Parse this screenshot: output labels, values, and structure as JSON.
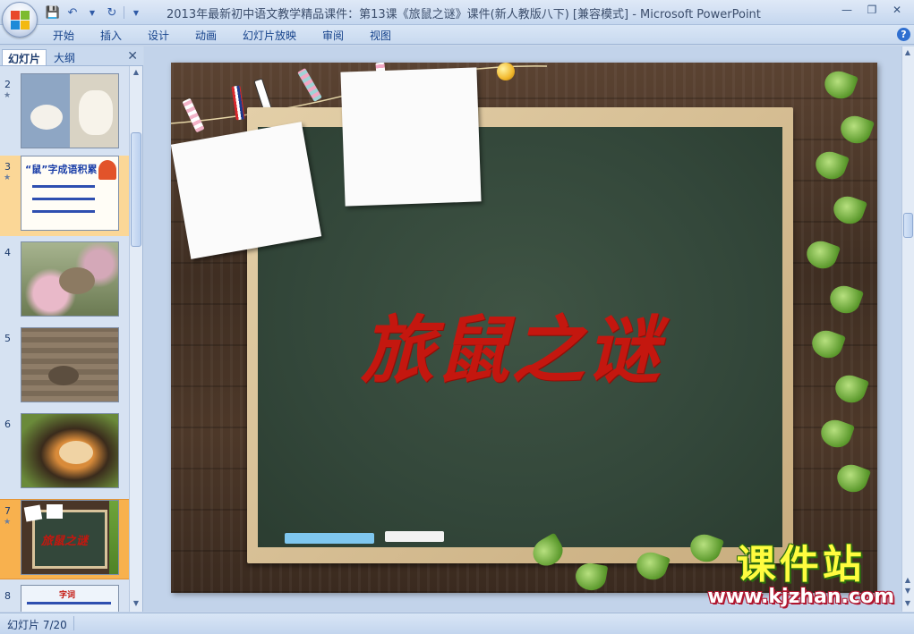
{
  "window": {
    "title": "2013年最新初中语文教学精品课件：第13课《旅鼠之谜》课件(新人教版八下) [兼容模式]",
    "app_name": "Microsoft PowerPoint"
  },
  "quick_access": {
    "save_icon": "save-icon",
    "undo_icon": "undo-icon",
    "redo_icon": "redo-icon"
  },
  "ribbon_tabs": [
    {
      "label": "开始"
    },
    {
      "label": "插入"
    },
    {
      "label": "设计"
    },
    {
      "label": "动画"
    },
    {
      "label": "幻灯片放映"
    },
    {
      "label": "审阅"
    },
    {
      "label": "视图"
    }
  ],
  "left_pane": {
    "tabs": [
      {
        "label": "幻灯片"
      },
      {
        "label": "大纲"
      }
    ],
    "slides": [
      {
        "number": "2",
        "has_animation": true
      },
      {
        "number": "3",
        "has_animation": true,
        "preview_title": "“鼠”字成语积累"
      },
      {
        "number": "4",
        "has_animation": false
      },
      {
        "number": "5",
        "has_animation": false
      },
      {
        "number": "6",
        "has_animation": false
      },
      {
        "number": "7",
        "has_animation": true,
        "selected": true,
        "preview_title": "旅鼠之谜"
      },
      {
        "number": "8",
        "has_animation": false,
        "preview_title": "字词"
      }
    ]
  },
  "slide": {
    "title": "旅鼠之谜"
  },
  "watermark": {
    "brand": "课件站",
    "url": "www.kjzhan.com"
  },
  "status_bar": {
    "slide_indicator": "幻灯片 7/20"
  },
  "colors": {
    "accent": "#f8b14e",
    "title_red": "#c4170f",
    "board_green": "#33473a"
  }
}
